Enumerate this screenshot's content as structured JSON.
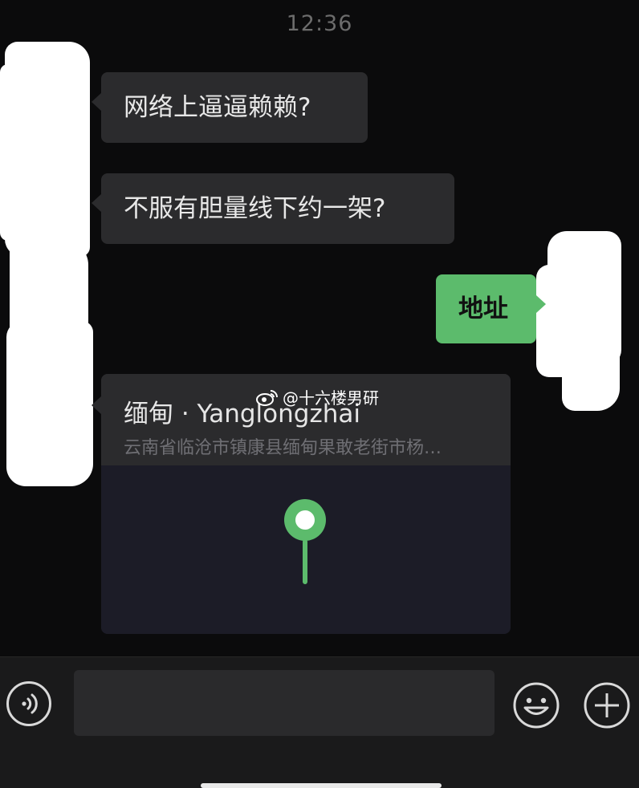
{
  "status": {
    "time": "12:36"
  },
  "messages": [
    {
      "text": "网络上逼逼赖赖?"
    },
    {
      "text": "不服有胆量线下约一架?"
    },
    {
      "text": "地址"
    }
  ],
  "location": {
    "title": "缅甸 · Yanglongzhai",
    "address": "云南省临沧市镇康县缅甸果敢老街市杨…"
  },
  "watermark": {
    "text": "@十六楼男研"
  },
  "colors": {
    "accent_green": "#5cbb6c",
    "bubble_dark": "#2b2b2d",
    "background": "#0b0b0c"
  },
  "icons": [
    "voice-icon",
    "emoji-icon",
    "plus-icon",
    "map-pin-icon",
    "weibo-icon"
  ]
}
